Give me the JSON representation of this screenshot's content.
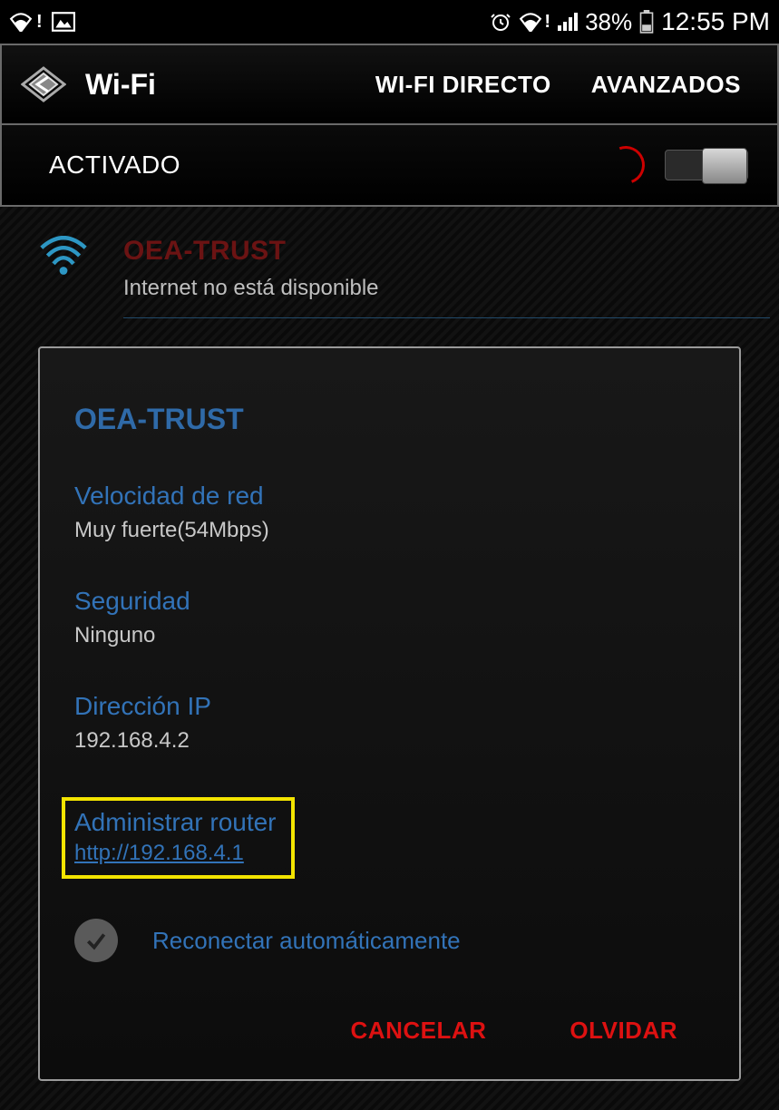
{
  "statusbar": {
    "battery_pct": "38%",
    "time": "12:55 PM"
  },
  "header": {
    "title": "Wi-Fi",
    "action_direct": "WI-FI DIRECTO",
    "action_advanced": "AVANZADOS"
  },
  "toggle": {
    "label": "ACTIVADO"
  },
  "network": {
    "name": "OEA-TRUST",
    "status": "Internet no está disponible"
  },
  "dialog": {
    "title": "OEA-TRUST",
    "speed_label": "Velocidad de red",
    "speed_value": "Muy fuerte(54Mbps)",
    "security_label": "Seguridad",
    "security_value": "Ninguno",
    "ip_label": "Dirección IP",
    "ip_value": "192.168.4.2",
    "router_label": "Administrar router",
    "router_link": "http://192.168.4.1",
    "auto_reconnect": "Reconectar automáticamente",
    "cancel": "CANCELAR",
    "forget": "OLVIDAR"
  }
}
